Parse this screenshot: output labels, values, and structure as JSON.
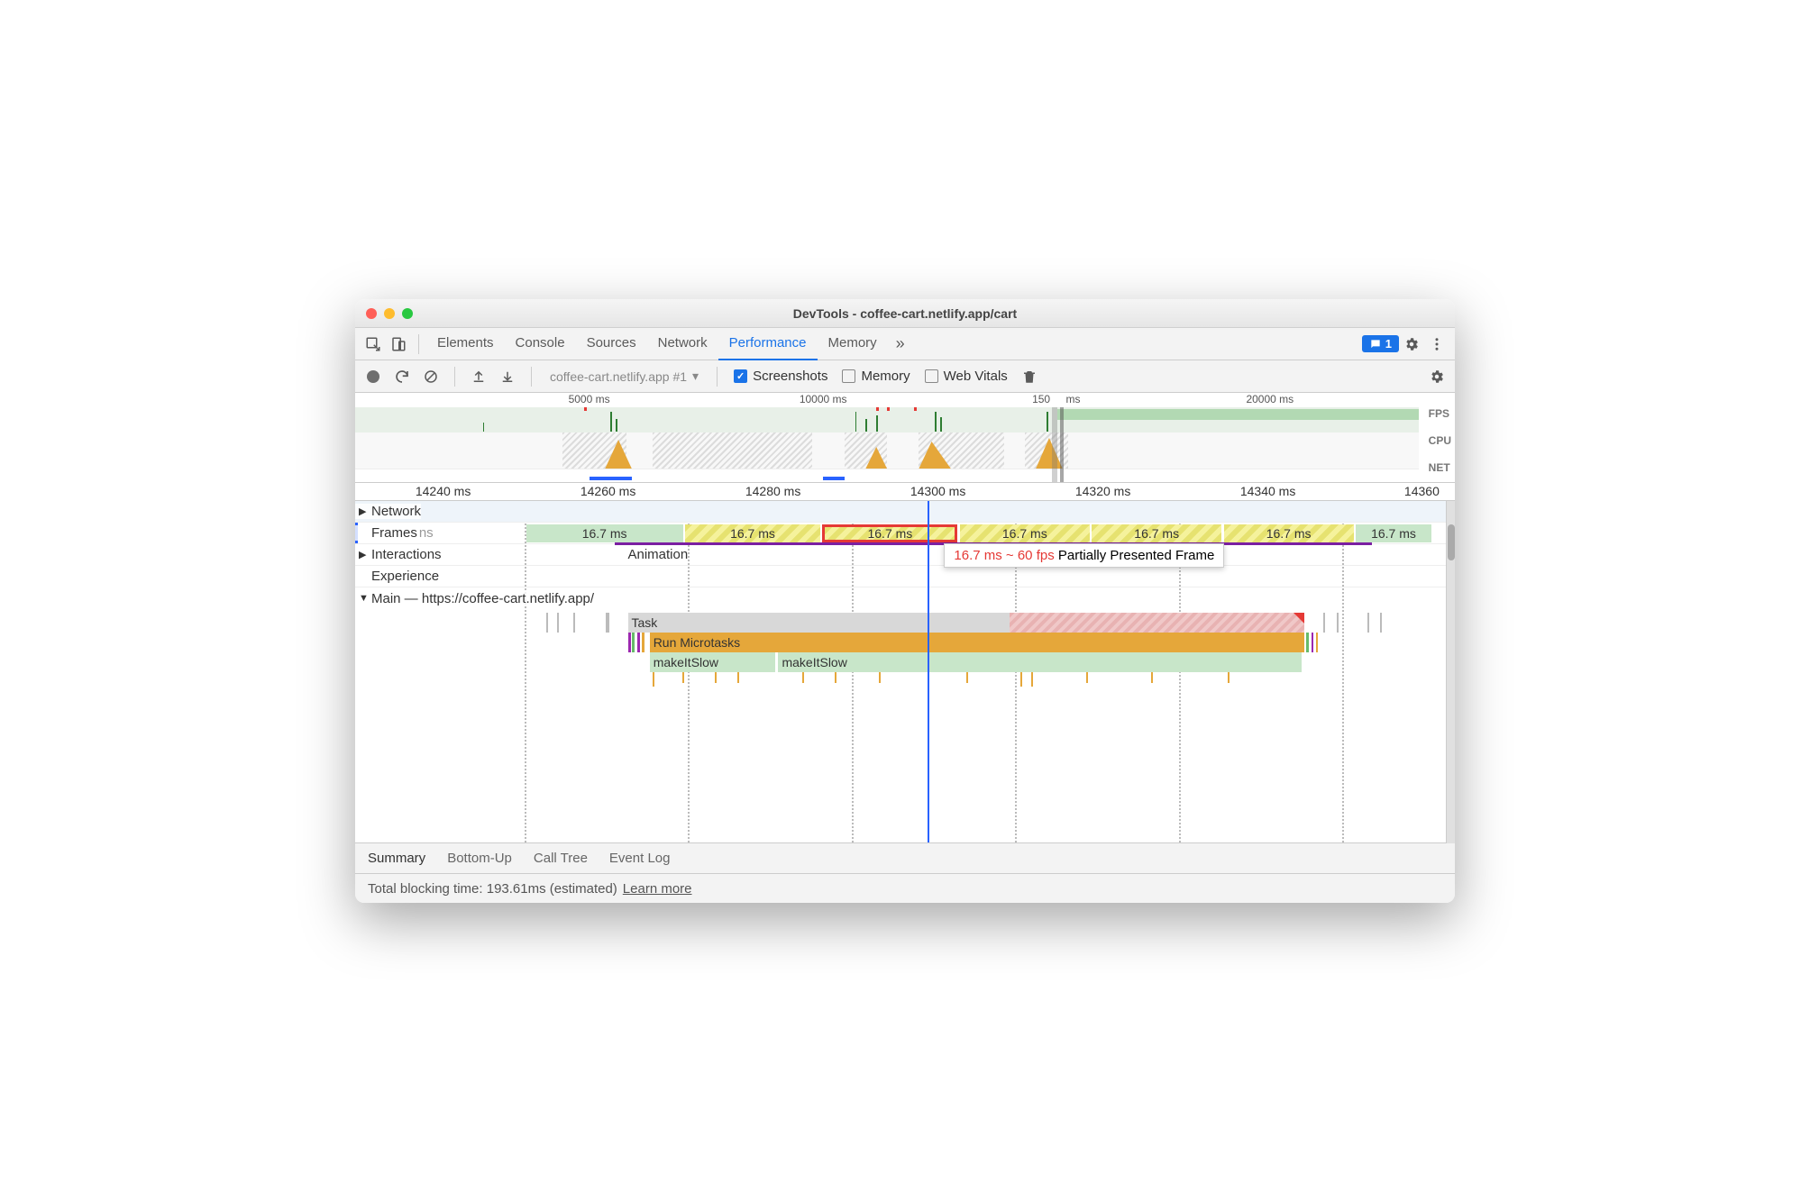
{
  "window": {
    "title": "DevTools - coffee-cart.netlify.app/cart"
  },
  "tabs": {
    "items": [
      "Elements",
      "Console",
      "Sources",
      "Network",
      "Performance",
      "Memory"
    ],
    "active": 4,
    "issues_count": "1"
  },
  "toolbar": {
    "dropdown": "coffee-cart.netlify.app #1",
    "cb_screenshots": "Screenshots",
    "cb_memory": "Memory",
    "cb_webvitals": "Web Vitals"
  },
  "overview": {
    "ticks": [
      "5000 ms",
      "10000 ms",
      "150",
      "ms",
      "20000 ms"
    ],
    "labels": [
      "FPS",
      "CPU",
      "NET"
    ]
  },
  "ruler": [
    "14240 ms",
    "14260 ms",
    "14280 ms",
    "14300 ms",
    "14320 ms",
    "14340 ms",
    "14360 ms"
  ],
  "tracks": {
    "network": "Network",
    "frames": "Frames",
    "frames_ns": "ns",
    "interactions": "Interactions",
    "animation": "Animation",
    "experience": "Experience",
    "main": "Main — https://coffee-cart.netlify.app/"
  },
  "frames": {
    "label": "16.7 ms",
    "tooltip_red": "16.7 ms ~ 60 fps",
    "tooltip_rest": "Partially Presented Frame"
  },
  "flame": {
    "task": "Task",
    "microtasks": "Run Microtasks",
    "fn": "makeItSlow"
  },
  "bottom_tabs": [
    "Summary",
    "Bottom-Up",
    "Call Tree",
    "Event Log"
  ],
  "status": {
    "text": "Total blocking time: 193.61ms (estimated)",
    "link": "Learn more"
  }
}
